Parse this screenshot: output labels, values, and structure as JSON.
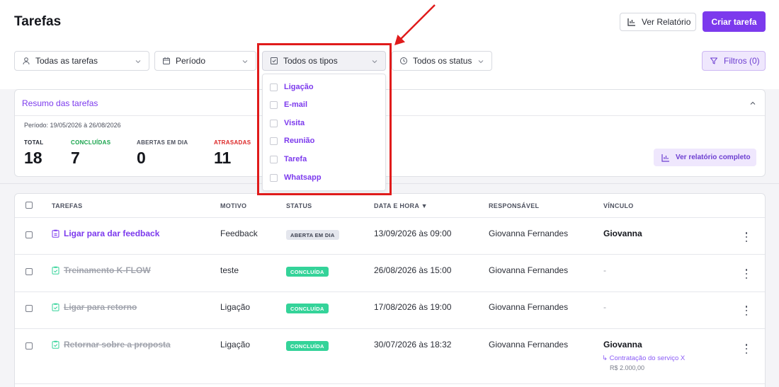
{
  "header": {
    "title": "Tarefas",
    "report_button": "Ver Relatório",
    "create_button": "Criar tarefa"
  },
  "filters": {
    "tasks": "Todas as tarefas",
    "period": "Período",
    "types": "Todos os tipos",
    "status": "Todos os status",
    "filters_button": "Filtros (0)"
  },
  "types_dropdown": {
    "options": [
      "Ligação",
      "E-mail",
      "Visita",
      "Reunião",
      "Tarefa",
      "Whatsapp"
    ]
  },
  "summary": {
    "title": "Resumo das tarefas",
    "period": "Período: 19/05/2026 à 26/08/2026",
    "stats": [
      {
        "label": "TOTAL",
        "value": "18",
        "color": "#1f2430"
      },
      {
        "label": "CONCLUÍDAS",
        "value": "7",
        "color": "#16a34a"
      },
      {
        "label": "ABERTAS EM DIA",
        "value": "0",
        "color": "#4b4f5c"
      },
      {
        "label": "ATRASADAS",
        "value": "11",
        "color": "#dc2626"
      }
    ],
    "full_report_button": "Ver relatório completo"
  },
  "table": {
    "columns": [
      "TAREFAS",
      "MOTIVO",
      "STATUS",
      "DATA E HORA ▼",
      "RESPONSÁVEL",
      "VÍNCULO"
    ],
    "rows": [
      {
        "task": "Ligar para dar feedback",
        "reason": "Feedback",
        "status": "ABERTA EM DIA",
        "datetime": "13/09/2026 às 09:00",
        "owner": "Giovanna Fernandes",
        "link": "Giovanna"
      },
      {
        "task": "Treinamento K-FLOW",
        "reason": "teste",
        "status": "CONCLUÍDA",
        "datetime": "26/08/2026 às 15:00",
        "owner": "Giovanna Fernandes",
        "link": "-"
      },
      {
        "task": "Ligar para retorno",
        "reason": "Ligação",
        "status": "CONCLUÍDA",
        "datetime": "17/08/2026 às 19:00",
        "owner": "Giovanna Fernandes",
        "link": "-"
      },
      {
        "task": "Retornar sobre a proposta",
        "reason": "Ligação",
        "status": "CONCLUÍDA",
        "datetime": "30/07/2026 às 18:32",
        "owner": "Giovanna Fernandes",
        "link": "Giovanna",
        "link_sub": "↳ Contratação do serviço X",
        "link_value": "R$ 2.000,00"
      }
    ]
  },
  "colors": {
    "accent": "#7c3aed",
    "done_badge": "#34d399",
    "highlight": "#e01b1b"
  }
}
